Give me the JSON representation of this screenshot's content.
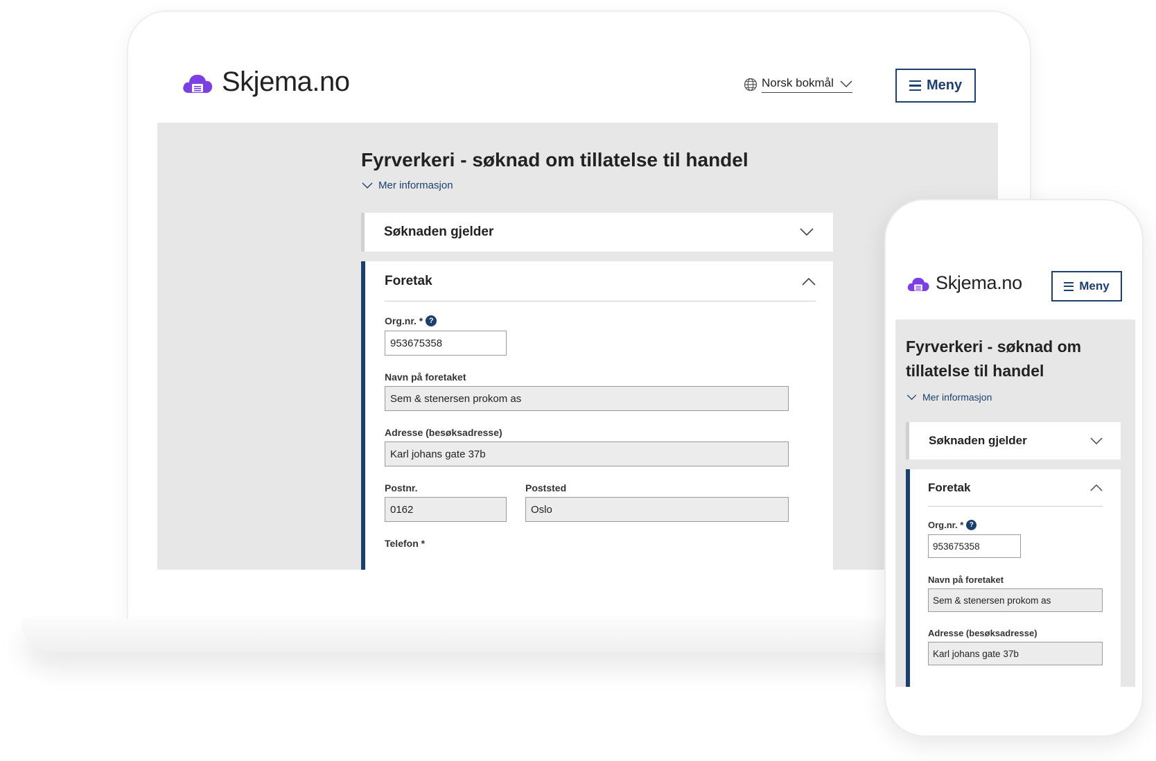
{
  "brand": {
    "name": "Skjema.no",
    "color": "#7b3fe4",
    "accent": "#1c3f6e"
  },
  "header": {
    "language": "Norsk bokmål",
    "menu_label": "Meny"
  },
  "form": {
    "title": "Fyrverkeri - søknad om tillatelse til handel",
    "title_mobile_line1": "Fyrverkeri - søknad om",
    "title_mobile_line2": "tillatelse til handel",
    "more_info": "Mer informasjon",
    "sections": [
      {
        "title": "Søknaden gjelder",
        "expanded": false
      },
      {
        "title": "Foretak",
        "expanded": true
      }
    ],
    "fields": {
      "orgnr": {
        "label": "Org.nr. *",
        "value": "953675358"
      },
      "navn": {
        "label": "Navn på foretaket",
        "value": "Sem & stenersen prokom as"
      },
      "adresse": {
        "label": "Adresse (besøksadresse)",
        "value": "Karl johans gate 37b"
      },
      "postnr": {
        "label": "Postnr.",
        "value": "0162"
      },
      "poststed": {
        "label": "Poststed",
        "value": "Oslo"
      },
      "telefon": {
        "label": "Telefon *"
      }
    },
    "help_icon": "?"
  }
}
